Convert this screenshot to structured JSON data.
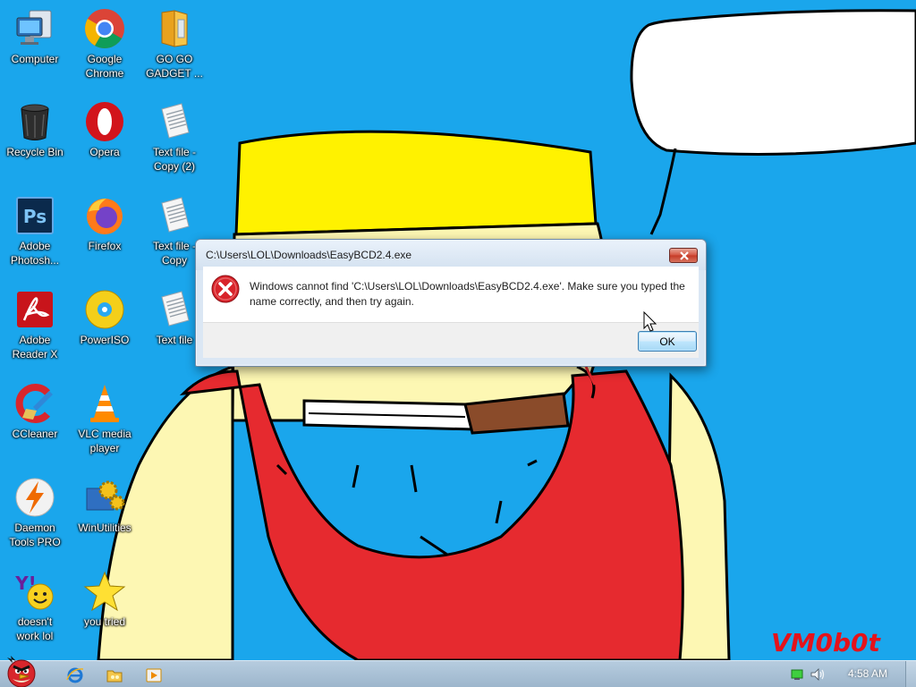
{
  "desktop": {
    "wallpaper": {
      "background_color": "#1aa6ec",
      "speech_bubble": "",
      "watermark": "VM0b0t"
    },
    "icons": [
      {
        "name": "computer",
        "label": "Computer",
        "icon": "computer-icon"
      },
      {
        "name": "google-chrome",
        "label": "Google\nChrome",
        "icon": "chrome-icon"
      },
      {
        "name": "go-go-gadget",
        "label": "GO GO\nGADGET ...",
        "icon": "folder-icon"
      },
      {
        "name": "recycle-bin",
        "label": "Recycle Bin",
        "icon": "recycle-bin-icon"
      },
      {
        "name": "opera",
        "label": "Opera",
        "icon": "opera-icon"
      },
      {
        "name": "text-file-1",
        "label": "Text file -\nCopy (2)",
        "icon": "text-file-icon"
      },
      {
        "name": "adobe-photoshop",
        "label": "Adobe\nPhotosh...",
        "icon": "photoshop-icon"
      },
      {
        "name": "firefox",
        "label": "Firefox",
        "icon": "firefox-icon"
      },
      {
        "name": "text-file-2",
        "label": "Text file -\nCopy",
        "icon": "text-file-icon"
      },
      {
        "name": "adobe-reader",
        "label": "Adobe\nReader X",
        "icon": "adobe-reader-icon"
      },
      {
        "name": "poweriso",
        "label": "PowerISO",
        "icon": "disc-icon"
      },
      {
        "name": "text-file-3",
        "label": "Text file",
        "icon": "text-file-icon"
      },
      {
        "name": "ccleaner",
        "label": "CCleaner",
        "icon": "ccleaner-icon"
      },
      {
        "name": "vlc",
        "label": "VLC media\nplayer",
        "icon": "vlc-cone-icon"
      },
      {
        "name": "daemon-tools",
        "label": "Daemon\nTools PRO",
        "icon": "lightning-icon"
      },
      {
        "name": "winutilities",
        "label": "WinUtilities",
        "icon": "gears-icon"
      },
      {
        "name": "yahoo-messenger",
        "label": "doesn't\nwork lol",
        "icon": "yahoo-messenger-icon"
      },
      {
        "name": "you-tried",
        "label": "you tried",
        "icon": "star-icon"
      }
    ]
  },
  "dialog": {
    "title": "C:\\Users\\LOL\\Downloads\\EasyBCD2.4.exe",
    "message": "Windows cannot find 'C:\\Users\\LOL\\Downloads\\EasyBCD2.4.exe'. Make sure you typed the name correctly, and then try again.",
    "ok_label": "OK",
    "icon": "error-icon"
  },
  "taskbar": {
    "start_icon": "angry-bird-icon",
    "pinned": [
      "internet-explorer-icon",
      "folder-icon",
      "media-player-icon"
    ],
    "tray": {
      "network_icon": "network-icon",
      "volume_icon": "speaker-icon"
    },
    "clock": "4:58 AM"
  },
  "colors": {
    "desktop": "#1aa6ec",
    "wallpaper_text": "#e02020",
    "dialog_frame": "#dbe7f4",
    "close_button": "#c53a25",
    "taskbar": "#9db6cc"
  }
}
